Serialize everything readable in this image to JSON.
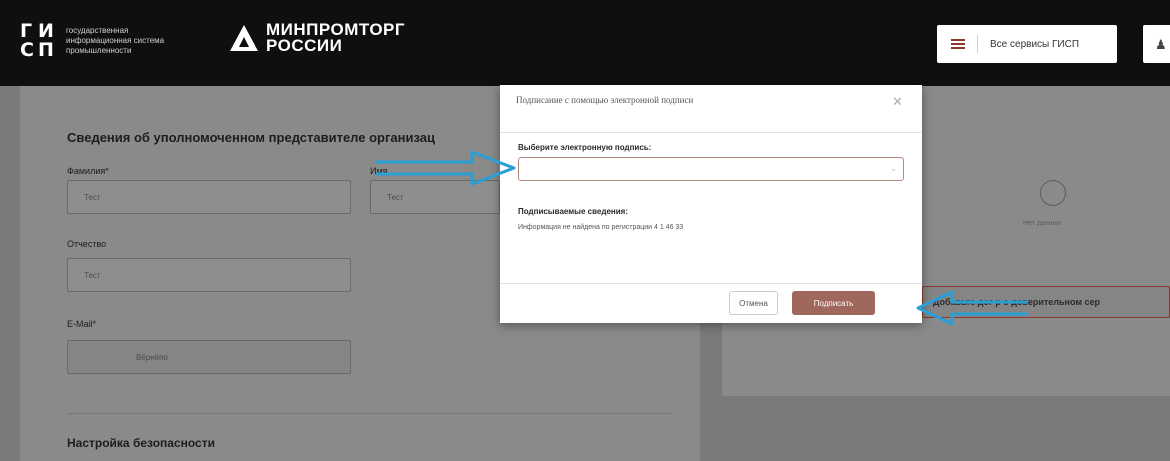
{
  "header": {
    "logo_mark": [
      "Г",
      "И",
      "С",
      "П"
    ],
    "logo_text_lines": [
      "государственная",
      "информационная система",
      "промышленности"
    ],
    "ministry_lines": [
      "МИНПРОМТОРГ",
      "РОССИИ"
    ],
    "services_label": "Все сервисы ГИСП",
    "user_icon": "user-icon"
  },
  "form": {
    "title": "Сведения об уполномоченном представителе организац",
    "surname_label": "Фамилия*",
    "surname_value": "Тест",
    "name_label": "Имя",
    "name_value": "Тест",
    "patronymic_label": "Отчество",
    "patronymic_value": "Тест",
    "email_label": "E-Mail*",
    "email_value": "Вёрнёпо",
    "security_title": "Настройка безопасности"
  },
  "right_panel": {
    "no_data": "Нет данных",
    "attach_text": "Добавьте дог   р о доверительном сер"
  },
  "modal": {
    "title": "Подписание с помощью электронной подписи",
    "close_icon": "close-icon",
    "signature_label": "Выберите электронную подпись:",
    "signature_value": "",
    "signer_label": "Подписываемые сведения:",
    "signer_info": "Информация не найдена по регистрации 4 1 46 33",
    "cancel_label": "Отмена",
    "sign_label": "Подписать"
  },
  "colors": {
    "header_bg": "#0f0f0f",
    "accent": "#a0675c",
    "arrow": "#2a9fd6"
  }
}
